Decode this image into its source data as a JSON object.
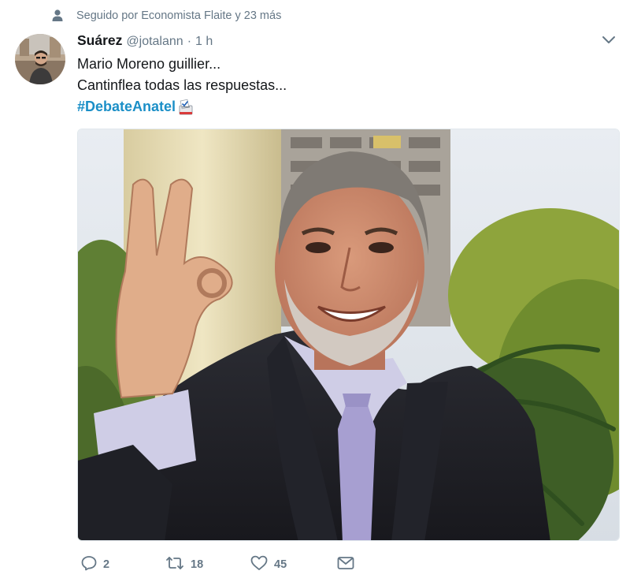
{
  "context": {
    "text": "Seguido por Economista Flaite y 23 más",
    "icon": "user-icon"
  },
  "tweet": {
    "display_name": "Suárez",
    "screen_name": "@jotalann",
    "separator": "·",
    "time": "1 h",
    "lines": [
      "Mario Moreno guillier...",
      "Cantinflea todas las respuestas..."
    ],
    "hashtag": "#DebateAnatel",
    "hashflag_icon": "ballot-box-icon",
    "caret_icon": "chevron-down-icon"
  },
  "actions": {
    "reply": {
      "icon": "reply-icon",
      "count": "2"
    },
    "retweet": {
      "icon": "retweet-icon",
      "count": "18"
    },
    "like": {
      "icon": "heart-icon",
      "count": "45"
    },
    "dm": {
      "icon": "envelope-icon"
    }
  },
  "colors": {
    "text": "#14171a",
    "secondary": "#657786",
    "link": "#1b8fc7"
  }
}
